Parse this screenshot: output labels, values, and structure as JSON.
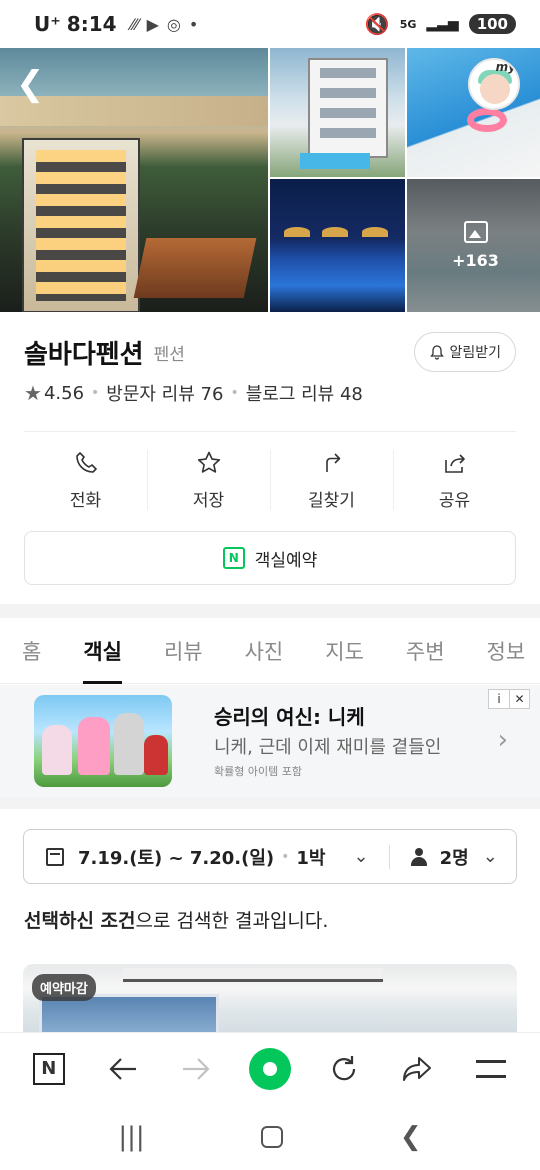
{
  "status_bar": {
    "carrier": "U⁺",
    "time": "8:14",
    "network": "5G",
    "battery": "100"
  },
  "gallery": {
    "more_count": "+163"
  },
  "place": {
    "name": "솔바다펜션",
    "category": "펜션",
    "alert_label": "알림받기",
    "rating": "4.56",
    "visitor_reviews": "방문자 리뷰 76",
    "blog_reviews": "블로그 리뷰 48"
  },
  "actions": [
    {
      "label": "전화",
      "icon": "phone-icon"
    },
    {
      "label": "저장",
      "icon": "star-outline-icon"
    },
    {
      "label": "길찾기",
      "icon": "directions-icon"
    },
    {
      "label": "공유",
      "icon": "share-icon"
    }
  ],
  "reserve_label": "객실예약",
  "tabs": [
    "홈",
    "객실",
    "리뷰",
    "사진",
    "지도",
    "주변",
    "정보"
  ],
  "active_tab": "객실",
  "ad": {
    "title": "승리의 여신: 니케",
    "description": "니케, 근데 이제 재미를 곁들인",
    "note": "확률형 아이템 포함",
    "info": "i",
    "close": "✕"
  },
  "filter": {
    "dates": "7.19.(토) ~ 7.20.(일)",
    "nights": "1박",
    "guests": "2명"
  },
  "result": {
    "bold": "선택하신 조건",
    "rest": "으로 검색한 결과입니다."
  },
  "room_badge": "예약마감",
  "browser_bar": {
    "n_label": "N"
  },
  "colors": {
    "naver_green": "#03c75a",
    "text_dark": "#111111",
    "text_gray": "#8a8a8a"
  }
}
